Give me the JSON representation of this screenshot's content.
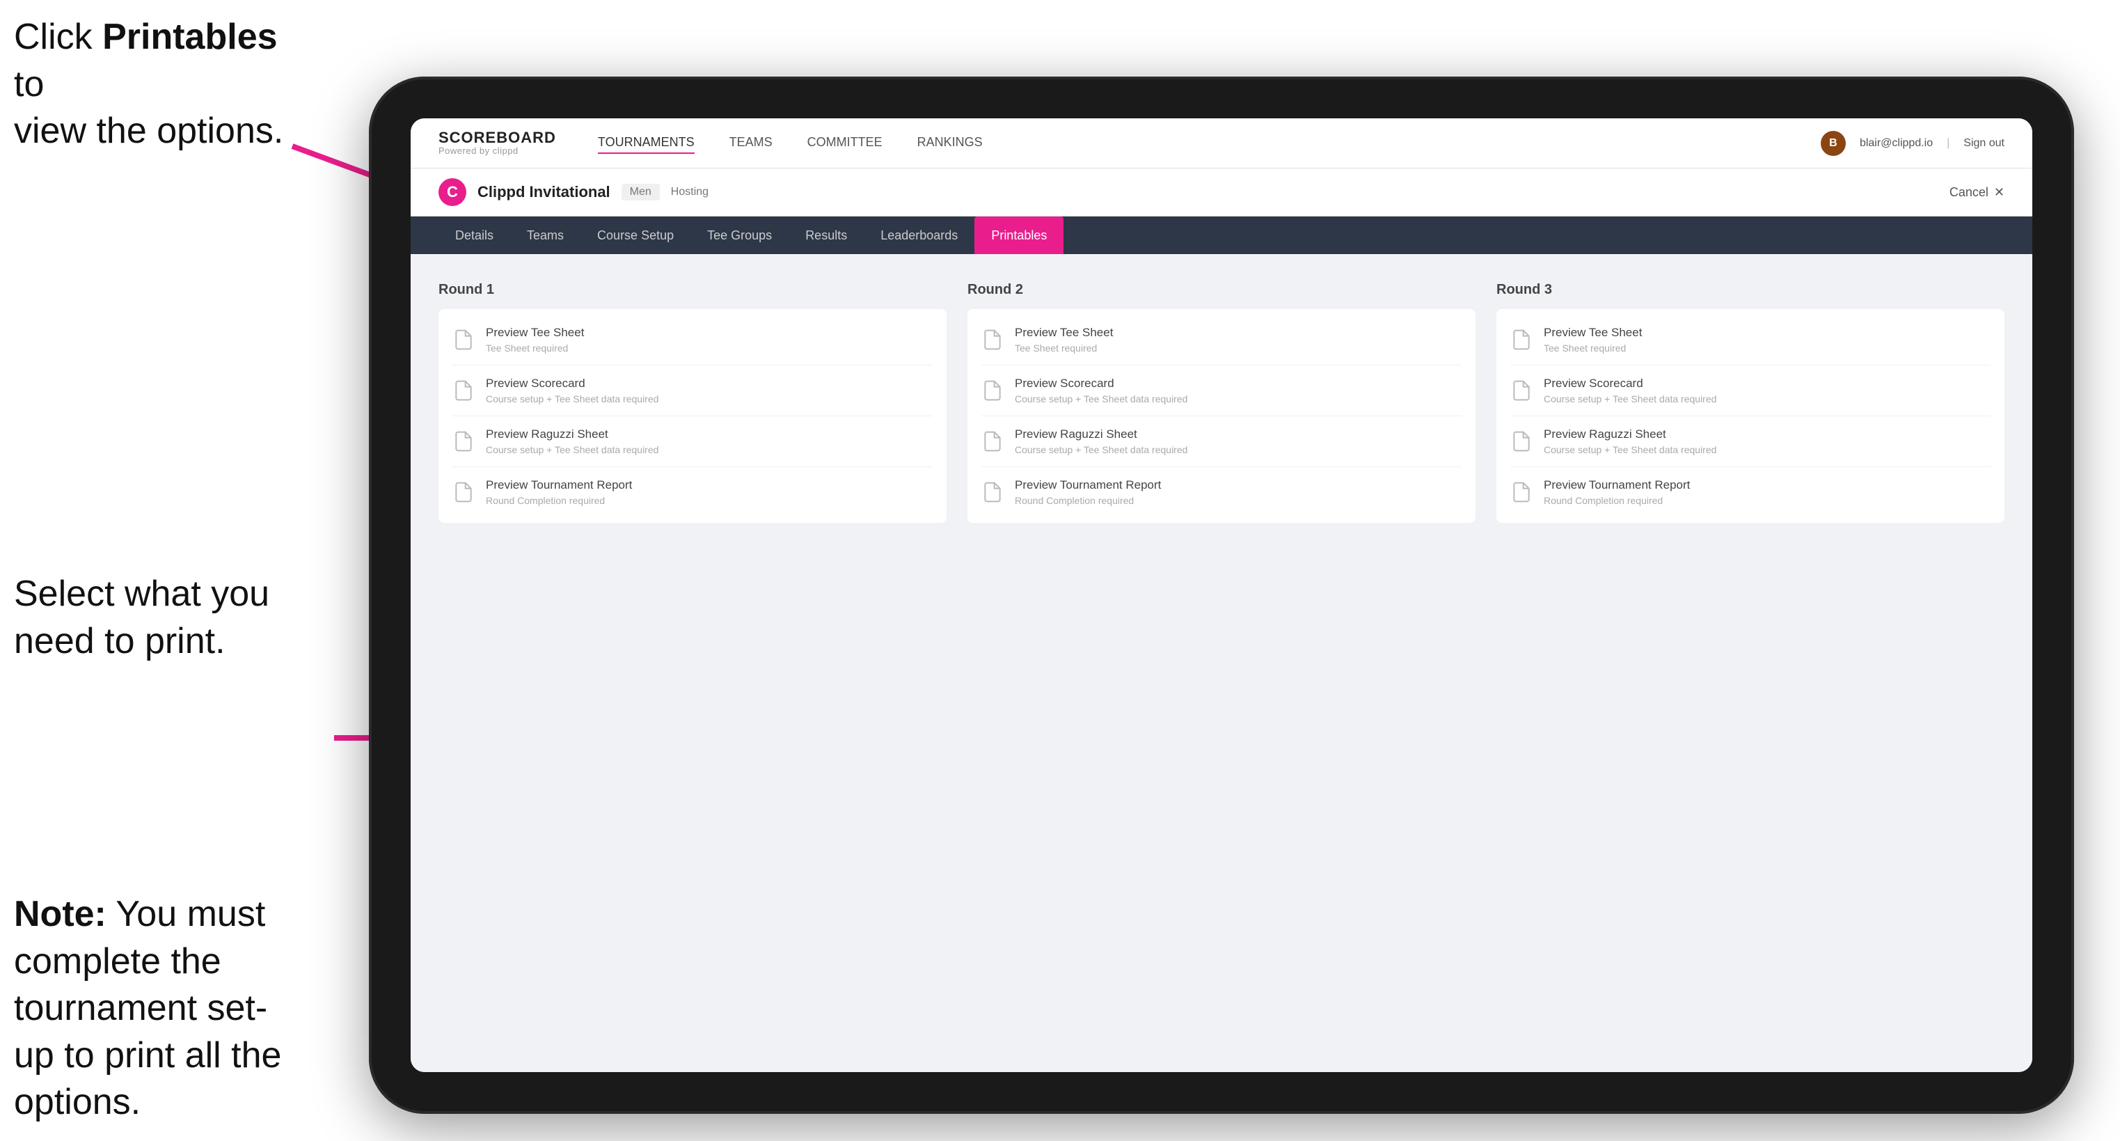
{
  "annotations": {
    "top": {
      "line1": "Click ",
      "bold": "Printables",
      "line2": " to",
      "line3": "view the options."
    },
    "middle": {
      "text": "Select what you need to print."
    },
    "bottom": {
      "note_bold": "Note:",
      "note_text": " You must complete the tournament set-up to print all the options."
    }
  },
  "topNav": {
    "logo_title": "SCOREBOARD",
    "logo_sub": "Powered by clippd",
    "links": [
      "TOURNAMENTS",
      "TEAMS",
      "COMMITTEE",
      "RANKINGS"
    ],
    "active_link": "TOURNAMENTS",
    "user_avatar_text": "B",
    "user_email": "blair@clippd.io",
    "sign_out": "Sign out"
  },
  "tournamentHeader": {
    "logo_text": "C",
    "name": "Clippd Invitational",
    "tag": "Men",
    "status": "Hosting",
    "cancel": "Cancel"
  },
  "subNav": {
    "tabs": [
      "Details",
      "Teams",
      "Course Setup",
      "Tee Groups",
      "Results",
      "Leaderboards",
      "Printables"
    ],
    "active_tab": "Printables"
  },
  "rounds": [
    {
      "label": "Round 1",
      "items": [
        {
          "title": "Preview Tee Sheet",
          "sub": "Tee Sheet required"
        },
        {
          "title": "Preview Scorecard",
          "sub": "Course setup + Tee Sheet data required"
        },
        {
          "title": "Preview Raguzzi Sheet",
          "sub": "Course setup + Tee Sheet data required"
        },
        {
          "title": "Preview Tournament Report",
          "sub": "Round Completion required"
        }
      ]
    },
    {
      "label": "Round 2",
      "items": [
        {
          "title": "Preview Tee Sheet",
          "sub": "Tee Sheet required"
        },
        {
          "title": "Preview Scorecard",
          "sub": "Course setup + Tee Sheet data required"
        },
        {
          "title": "Preview Raguzzi Sheet",
          "sub": "Course setup + Tee Sheet data required"
        },
        {
          "title": "Preview Tournament Report",
          "sub": "Round Completion required"
        }
      ]
    },
    {
      "label": "Round 3",
      "items": [
        {
          "title": "Preview Tee Sheet",
          "sub": "Tee Sheet required"
        },
        {
          "title": "Preview Scorecard",
          "sub": "Course setup + Tee Sheet data required"
        },
        {
          "title": "Preview Raguzzi Sheet",
          "sub": "Course setup + Tee Sheet data required"
        },
        {
          "title": "Preview Tournament Report",
          "sub": "Round Completion required"
        }
      ]
    }
  ]
}
